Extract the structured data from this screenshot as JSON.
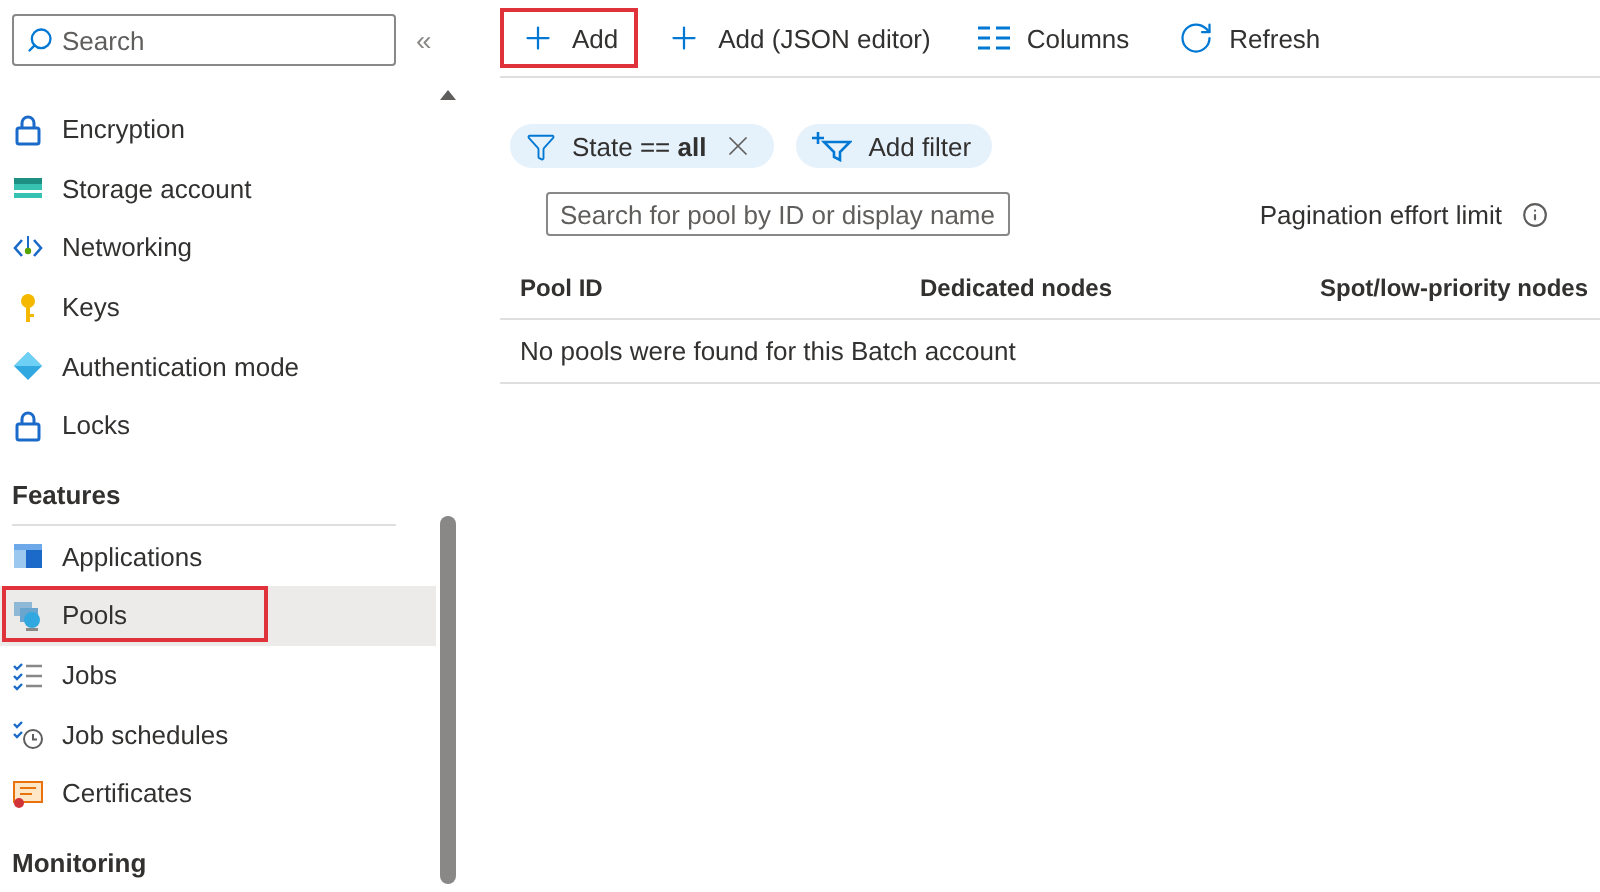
{
  "sidebar": {
    "search": {
      "placeholder": "Search"
    },
    "collapse": "«",
    "groups": [
      {
        "items": [
          {
            "label": "Encryption",
            "kind": "lock",
            "selected": false,
            "highlighted": false
          },
          {
            "label": "Storage account",
            "kind": "storage",
            "selected": false,
            "highlighted": false
          },
          {
            "label": "Networking",
            "kind": "network",
            "selected": false,
            "highlighted": false
          },
          {
            "label": "Keys",
            "kind": "key",
            "selected": false,
            "highlighted": false
          },
          {
            "label": "Authentication mode",
            "kind": "auth",
            "selected": false,
            "highlighted": false
          },
          {
            "label": "Locks",
            "kind": "lock",
            "selected": false,
            "highlighted": false
          }
        ]
      },
      {
        "heading": "Features",
        "items": [
          {
            "label": "Applications",
            "kind": "app",
            "selected": false,
            "highlighted": false
          },
          {
            "label": "Pools",
            "kind": "pool",
            "selected": true,
            "highlighted": true
          },
          {
            "label": "Jobs",
            "kind": "jobs",
            "selected": false,
            "highlighted": false
          },
          {
            "label": "Job schedules",
            "kind": "schedule",
            "selected": false,
            "highlighted": false
          },
          {
            "label": "Certificates",
            "kind": "cert",
            "selected": false,
            "highlighted": false
          }
        ]
      },
      {
        "heading": "Monitoring"
      }
    ]
  },
  "toolbar": [
    {
      "label": "Add",
      "kind": "add",
      "highlighted": true
    },
    {
      "label": "Add (JSON editor)",
      "kind": "add",
      "highlighted": false
    },
    {
      "label": "Columns",
      "kind": "columns",
      "highlighted": false
    },
    {
      "label": "Refresh",
      "kind": "refresh",
      "highlighted": false
    }
  ],
  "filters": [
    {
      "label": "State == **all**",
      "kind": "active"
    },
    {
      "label": "Add filter",
      "kind": "add"
    }
  ],
  "pool_search": {
    "placeholder": "Search for pool by ID or display name"
  },
  "pagination": {
    "label": "Pagination effort limit"
  },
  "table": {
    "columns": [
      "Pool ID",
      "Dedicated nodes",
      "Spot/low-priority nodes"
    ],
    "empty_message": "No pools were found for this Batch account"
  }
}
